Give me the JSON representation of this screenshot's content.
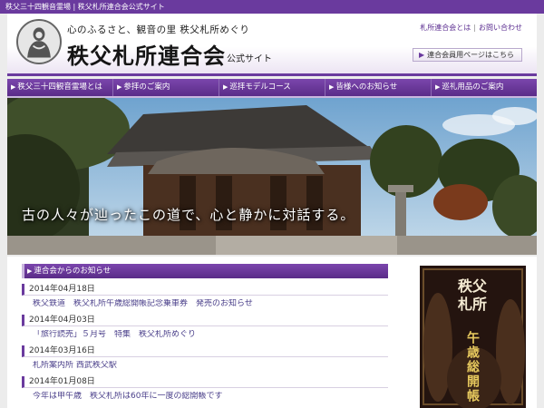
{
  "top_strip": {
    "text": "秩父三十四観音霊場 | 秩父札所連合会公式サイト"
  },
  "header": {
    "tagline": "心のふるさと、観音の里 秩父札所めぐり",
    "title": "秩父札所連合会",
    "title_sub": "公式サイト",
    "links": [
      "札所連合会とは",
      "お問い合わせ"
    ],
    "member_button": "連合会員用ページはこちら"
  },
  "nav": {
    "items": [
      "秩父三十四観音霊場とは",
      "参拝のご案内",
      "巡拝モデルコース",
      "皆様へのお知らせ",
      "巡礼用品のご案内"
    ]
  },
  "hero": {
    "caption": "古の人々が辿ったこの道で、心と静かに対話する。"
  },
  "news": {
    "heading": "連合会からのお知らせ",
    "items": [
      {
        "date": "2014年04月18日",
        "title": "秩父鉄道　秩父札所午歳総開帳記念乗車券　発売のお知らせ"
      },
      {
        "date": "2014年04月03日",
        "title": "「旅行読売」５月号　特集　秩父札所めぐり"
      },
      {
        "date": "2014年03月16日",
        "title": "札所案内所 西武秩父駅"
      },
      {
        "date": "2014年01月08日",
        "title": "今年は甲午歳　秩父札所は60年に一度の総開帳です"
      }
    ]
  },
  "poster": {
    "line1": "秩父",
    "line2": "札所",
    "main": "午歳総開帳"
  },
  "colors": {
    "brand_purple": "#6a3a9e",
    "nav_purple": "#5a2c88",
    "link": "#4a3f8a"
  },
  "icons": {
    "nav_arrow": "triangle-right-icon",
    "logo": "kannon-logo-icon"
  }
}
